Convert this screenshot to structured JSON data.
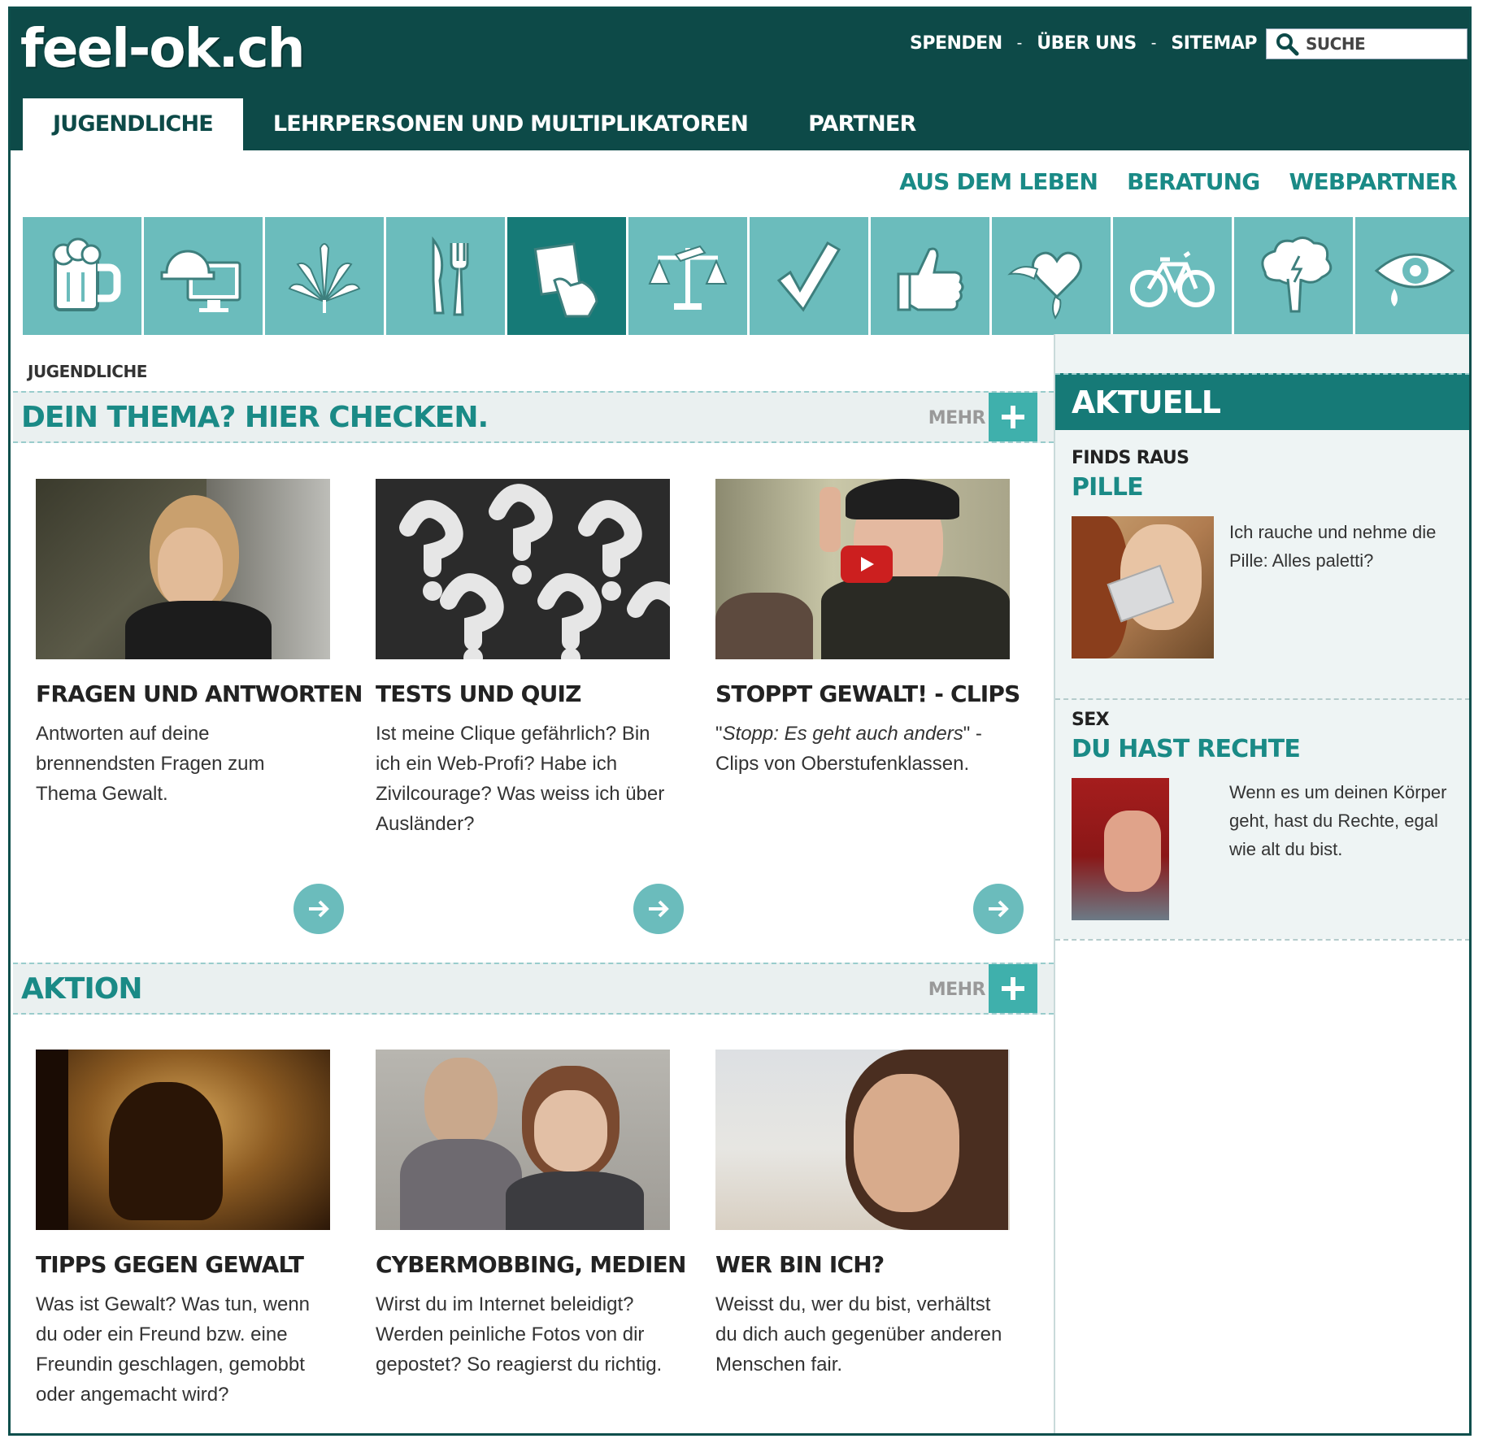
{
  "header": {
    "logo": "feel-ok.ch",
    "links": [
      "SPENDEN",
      "ÜBER UNS",
      "SITEMAP"
    ],
    "separator": "-",
    "search_placeholder": "SUCHE",
    "tabs": [
      "JUGENDLICHE",
      "LEHRPERSONEN UND MULTIPLIKATOREN",
      "PARTNER"
    ]
  },
  "subnav": [
    "AUS DEM LEBEN",
    "BERATUNG",
    "WEBPARTNER"
  ],
  "icons": [
    "beer-mug-icon",
    "helmet-computer-icon",
    "cannabis-leaf-icon",
    "knife-fork-icon",
    "hand-card-icon",
    "scales-icon",
    "checkmark-icon",
    "thumbs-up-icon",
    "winged-heart-icon",
    "bicycle-icon",
    "tree-icon",
    "crying-eye-icon"
  ],
  "breadcrumb": "JUGENDLICHE",
  "sections": [
    {
      "title": "DEIN THEMA? HIER CHECKEN.",
      "more": "MEHR",
      "cards": [
        {
          "title": "FRAGEN UND ANTWORTEN",
          "text": "Antworten auf deine brennendsten Fragen zum Thema Gewalt."
        },
        {
          "title": "TESTS UND QUIZ",
          "text": "Ist meine Clique gefährlich? Bin ich ein Web-Profi? Habe ich Zivilcourage? Was weiss ich über Ausländer?"
        },
        {
          "title": "STOPPT GEWALT! - CLIPS",
          "text_italic": "Stopp: Es geht auch anders",
          "text_rest": " - Clips von Oberstufenklassen.",
          "quote": "\""
        }
      ]
    },
    {
      "title": "AKTION",
      "more": "MEHR",
      "cards": [
        {
          "title": "TIPPS GEGEN GEWALT",
          "text": "Was ist Gewalt? Was tun, wenn du oder ein Freund bzw. eine Freundin geschlagen, gemobbt oder angemacht wird?"
        },
        {
          "title": "CYBERMOBBING, MEDIEN",
          "text": "Wirst du im Internet beleidigt? Werden peinliche Fotos von dir gepostet? So reagierst du richtig."
        },
        {
          "title": "WER BIN ICH?",
          "text": "Weisst du, wer du bist, verhältst du dich auch gegenüber anderen Menschen fair."
        }
      ]
    }
  ],
  "sidebar": {
    "title": "AKTUELL",
    "items": [
      {
        "category": "FINDS RAUS",
        "title": "PILLE",
        "text": "Ich rauche und nehme die Pille: Alles paletti?"
      },
      {
        "category": "SEX",
        "title": "DU HAST RECHTE",
        "text": "Wenn es um deinen Körper geht, hast du Rechte, egal wie alt du bist."
      }
    ]
  },
  "colors": {
    "dark_teal": "#0d4a48",
    "accent": "#1a8a86",
    "icon_bg": "#6bbcbc",
    "icon_active": "#167a77"
  }
}
